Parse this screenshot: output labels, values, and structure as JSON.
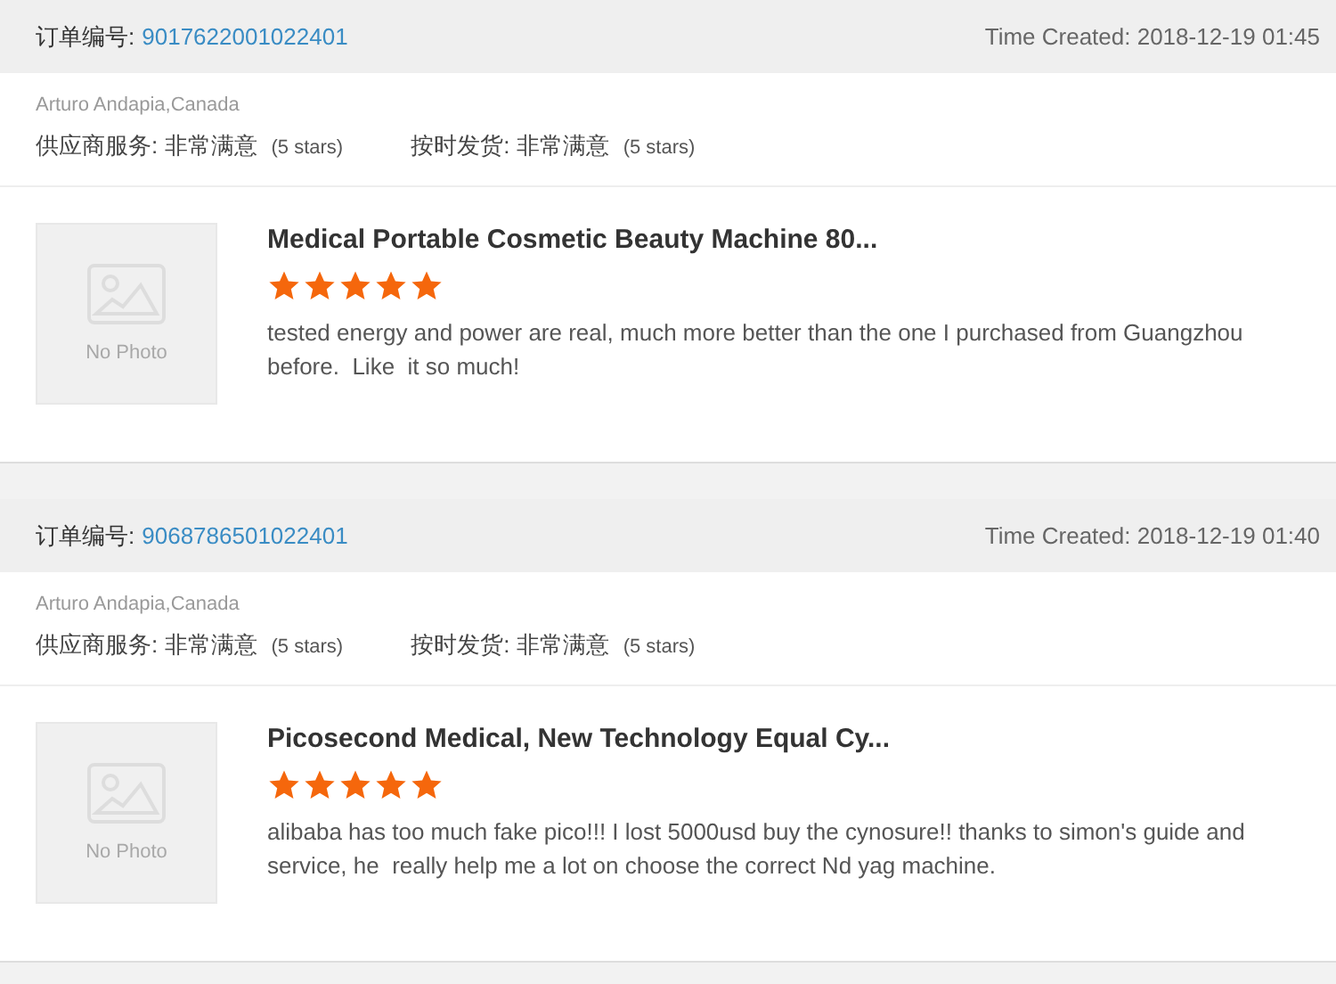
{
  "orders": [
    {
      "order_label": "订单编号:",
      "order_number": "9017622001022401",
      "time_created": "Time Created: 2018-12-19 01:45",
      "buyer": "Arturo Andapia,Canada",
      "ratings": [
        {
          "label": "供应商服务:",
          "value": "非常满意",
          "stars_text": "(5 stars)"
        },
        {
          "label": "按时发货:",
          "value": "非常满意",
          "stars_text": "(5 stars)"
        }
      ],
      "product": {
        "photo_text": "No Photo",
        "title": "Medical Portable Cosmetic Beauty Machine 80...",
        "stars": 5,
        "review": "tested energy and power are real, much more better than the one I purchased from Guangzhou before.  Like  it so much!"
      }
    },
    {
      "order_label": "订单编号:",
      "order_number": "9068786501022401",
      "time_created": "Time Created: 2018-12-19 01:40",
      "buyer": "Arturo Andapia,Canada",
      "ratings": [
        {
          "label": "供应商服务:",
          "value": "非常满意",
          "stars_text": "(5 stars)"
        },
        {
          "label": "按时发货:",
          "value": "非常满意",
          "stars_text": "(5 stars)"
        }
      ],
      "product": {
        "photo_text": "No Photo",
        "title": "Picosecond Medical, New Technology Equal Cy...",
        "stars": 5,
        "review": "alibaba has too much fake pico!!! I lost 5000usd buy the cynosure!! thanks to simon's guide and service, he  really help me a lot on choose the correct Nd yag machine."
      }
    }
  ]
}
